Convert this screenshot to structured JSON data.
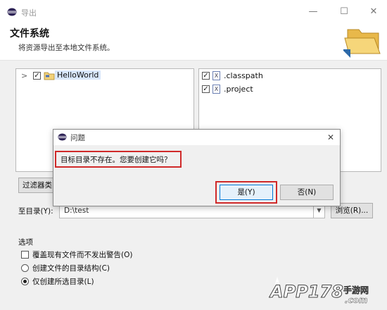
{
  "window": {
    "title": "导出",
    "controls": {
      "minimize": "—",
      "maximize": "☐",
      "close": "✕"
    }
  },
  "header": {
    "title": "文件系统",
    "description": "将资源导出至本地文件系统。"
  },
  "left_tree": {
    "items": [
      {
        "label": "HelloWorld",
        "checked": true,
        "icon": "project-folder-icon",
        "expand": ">"
      }
    ]
  },
  "right_tree": {
    "items": [
      {
        "label": ".classpath",
        "checked": true,
        "icon": "file-x-icon",
        "glyph": "X"
      },
      {
        "label": ".project",
        "checked": true,
        "icon": "file-x-icon",
        "glyph": "X"
      }
    ]
  },
  "buttons": {
    "filter": "过滤器类型",
    "browse": "浏览(R)..."
  },
  "destination": {
    "label": "至目录(Y):",
    "value": "D:\\test"
  },
  "options": {
    "group_label": "选项",
    "overwrite": "覆盖现有文件而不发出警告(O)",
    "create_structure": "创建文件的目录结构(C)",
    "create_selected": "仅创建所选目录(L)",
    "selected_option": "create_selected"
  },
  "dialog": {
    "title": "问题",
    "message": "目标目录不存在。您要创建它吗？",
    "yes": "是(Y)",
    "no": "否(N)",
    "close": "✕"
  },
  "watermark": {
    "brand": "APP178",
    "suffix": "手游网",
    "domain": ".com"
  },
  "colors": {
    "highlight_red": "#d02a2a",
    "focus_blue": "#0078d7",
    "tree_selection": "#d8e7fb"
  }
}
